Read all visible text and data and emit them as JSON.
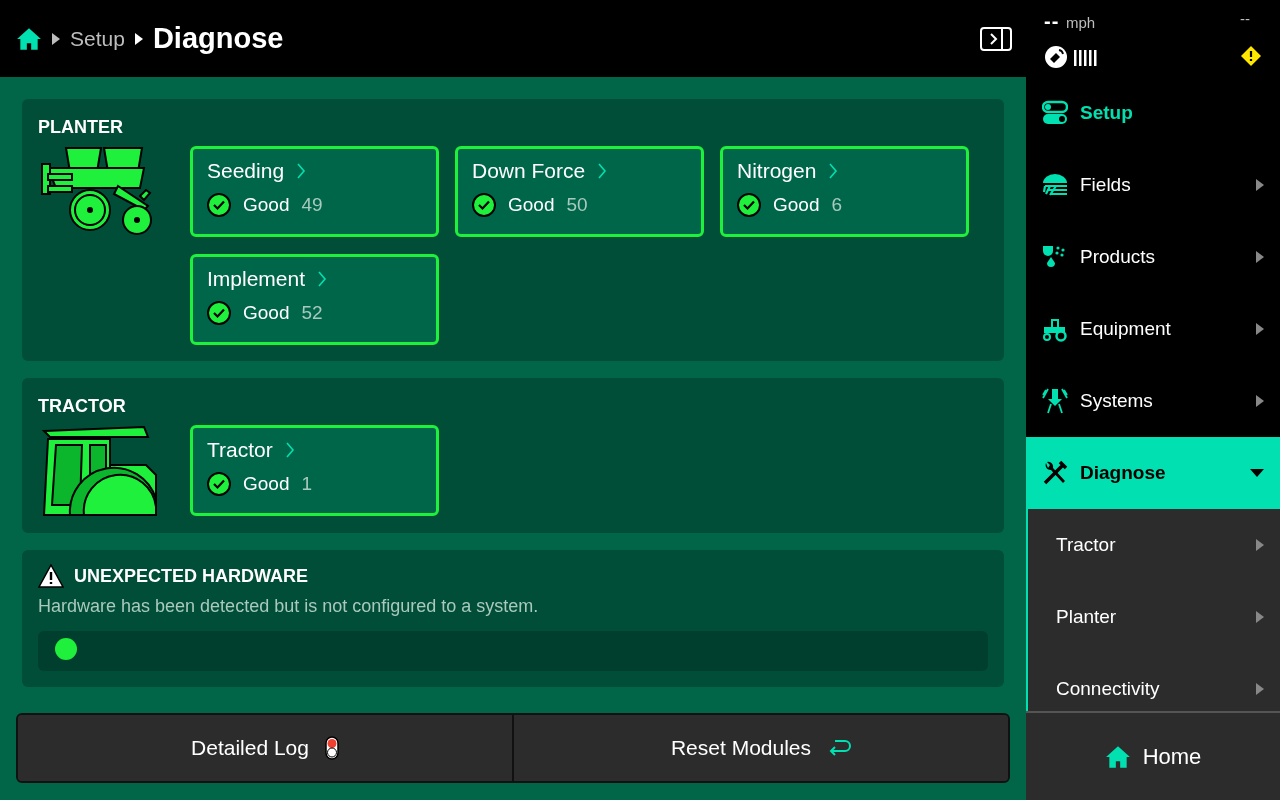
{
  "header": {
    "breadcrumb": [
      "Setup"
    ],
    "title": "Diagnose"
  },
  "status": {
    "speed": "--",
    "unit": "mph",
    "right": "--",
    "warning": true
  },
  "sections": [
    {
      "kind": "equipment",
      "heading": "PLANTER",
      "modules": [
        {
          "name": "Seeding",
          "status": "Good",
          "count": "49"
        },
        {
          "name": "Down Force",
          "status": "Good",
          "count": "50"
        },
        {
          "name": "Nitrogen",
          "status": "Good",
          "count": "6"
        },
        {
          "name": "Implement",
          "status": "Good",
          "count": "52"
        }
      ]
    },
    {
      "kind": "equipment",
      "heading": "TRACTOR",
      "modules": [
        {
          "name": "Tractor",
          "status": "Good",
          "count": "1"
        }
      ]
    },
    {
      "kind": "warning",
      "heading": "UNEXPECTED HARDWARE",
      "description": "Hardware has been detected but is not configured to a system."
    }
  ],
  "actions": [
    {
      "label": "Detailed Log"
    },
    {
      "label": "Reset Modules"
    }
  ],
  "sidebar": {
    "items": [
      {
        "kind": "header",
        "label": "Setup"
      },
      {
        "kind": "menu",
        "label": "Fields",
        "selected": false,
        "expanded": false
      },
      {
        "kind": "menu",
        "label": "Products",
        "selected": false,
        "expanded": false
      },
      {
        "kind": "menu",
        "label": "Equipment",
        "selected": false,
        "expanded": false
      },
      {
        "kind": "menu",
        "label": "Systems",
        "selected": false,
        "expanded": false
      },
      {
        "kind": "menu",
        "label": "Diagnose",
        "selected": true,
        "expanded": true,
        "children": [
          {
            "label": "Tractor"
          },
          {
            "label": "Planter"
          },
          {
            "label": "Connectivity"
          }
        ]
      }
    ],
    "home": "Home"
  }
}
